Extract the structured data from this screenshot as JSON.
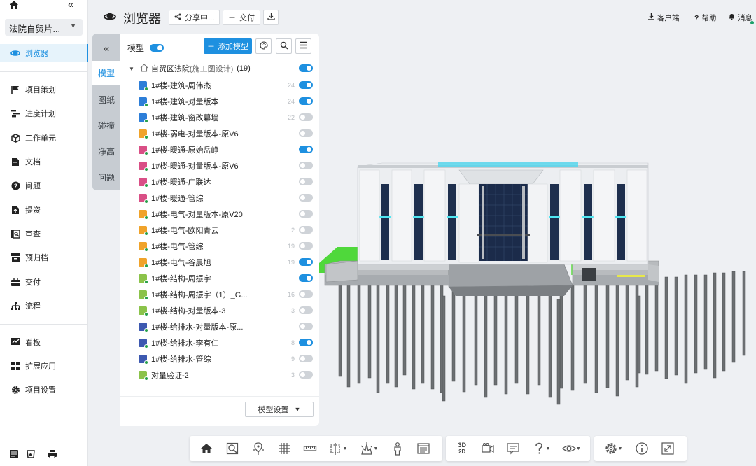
{
  "nav": {
    "project": "法院自贸片...",
    "items": [
      {
        "label": "浏览器",
        "icon": "browser-icon"
      },
      {
        "label": "项目策划",
        "icon": "flag-icon"
      },
      {
        "label": "进度计划",
        "icon": "schedule-icon"
      },
      {
        "label": "工作单元",
        "icon": "cube-icon"
      },
      {
        "label": "文档",
        "icon": "document-icon"
      },
      {
        "label": "问题",
        "icon": "question-icon"
      },
      {
        "label": "提资",
        "icon": "upload-icon"
      },
      {
        "label": "审查",
        "icon": "review-icon"
      },
      {
        "label": "预归档",
        "icon": "archive-icon"
      },
      {
        "label": "交付",
        "icon": "deliver-icon"
      },
      {
        "label": "流程",
        "icon": "flow-icon"
      },
      {
        "label": "看板",
        "icon": "dashboard-icon"
      },
      {
        "label": "扩展应用",
        "icon": "apps-icon"
      },
      {
        "label": "项目设置",
        "icon": "gear-icon"
      }
    ]
  },
  "header": {
    "title": "浏览器",
    "share": "分享中...",
    "deliver": "交付",
    "client": "客户端",
    "help": "帮助",
    "messages": "消息"
  },
  "tabs": [
    "模型",
    "图纸",
    "碰撞",
    "净高",
    "问题"
  ],
  "panel": {
    "label": "模型",
    "add_button": "添加模型",
    "root_name": "自贸区法院",
    "root_sub": "(施工图设计)",
    "root_count": "(19)",
    "settings_button": "模型设置",
    "models": [
      {
        "name": "1#楼-建筑-周伟杰",
        "num": "24",
        "on": true,
        "color": "blue"
      },
      {
        "name": "1#楼-建筑-对量版本",
        "num": "24",
        "on": true,
        "color": "blue"
      },
      {
        "name": "1#楼-建筑-窗改幕墙",
        "num": "22",
        "on": false,
        "color": "blue"
      },
      {
        "name": "1#楼-弱电-对量版本-原V6",
        "num": "",
        "on": false,
        "color": "orange"
      },
      {
        "name": "1#楼-暖通-原始岳峥",
        "num": "",
        "on": true,
        "color": "pink"
      },
      {
        "name": "1#楼-暖通-对量版本-原V6",
        "num": "",
        "on": false,
        "color": "pink"
      },
      {
        "name": "1#楼-暖通-广联达",
        "num": "",
        "on": false,
        "color": "pink"
      },
      {
        "name": "1#楼-暖通-管综",
        "num": "",
        "on": false,
        "color": "pink"
      },
      {
        "name": "1#楼-电气-对量版本-原V20",
        "num": "",
        "on": false,
        "color": "orange"
      },
      {
        "name": "1#楼-电气-欧阳青云",
        "num": "2",
        "on": false,
        "color": "orange"
      },
      {
        "name": "1#楼-电气-管综",
        "num": "19",
        "on": false,
        "color": "orange"
      },
      {
        "name": "1#楼-电气-谷晨旭",
        "num": "19",
        "on": true,
        "color": "orange"
      },
      {
        "name": "1#楼-结构-周振宇",
        "num": "",
        "on": true,
        "color": "green"
      },
      {
        "name": "1#楼-结构-周振宇（1）_G...",
        "num": "16",
        "on": false,
        "color": "green"
      },
      {
        "name": "1#楼-结构-对量版本-3",
        "num": "3",
        "on": false,
        "color": "green"
      },
      {
        "name": "1#楼-给排水-对量版本-原...",
        "num": "",
        "on": false,
        "color": "navy"
      },
      {
        "name": "1#楼-给排水-李有仁",
        "num": "8",
        "on": true,
        "color": "navy"
      },
      {
        "name": "1#楼-给排水-管综",
        "num": "9",
        "on": false,
        "color": "navy"
      },
      {
        "name": "对量验证-2",
        "num": "3",
        "on": false,
        "color": "green"
      }
    ]
  },
  "toolbar": {
    "view3d": "3D",
    "view2d": "2D"
  },
  "colors": {
    "accent": "#1e90e0"
  }
}
